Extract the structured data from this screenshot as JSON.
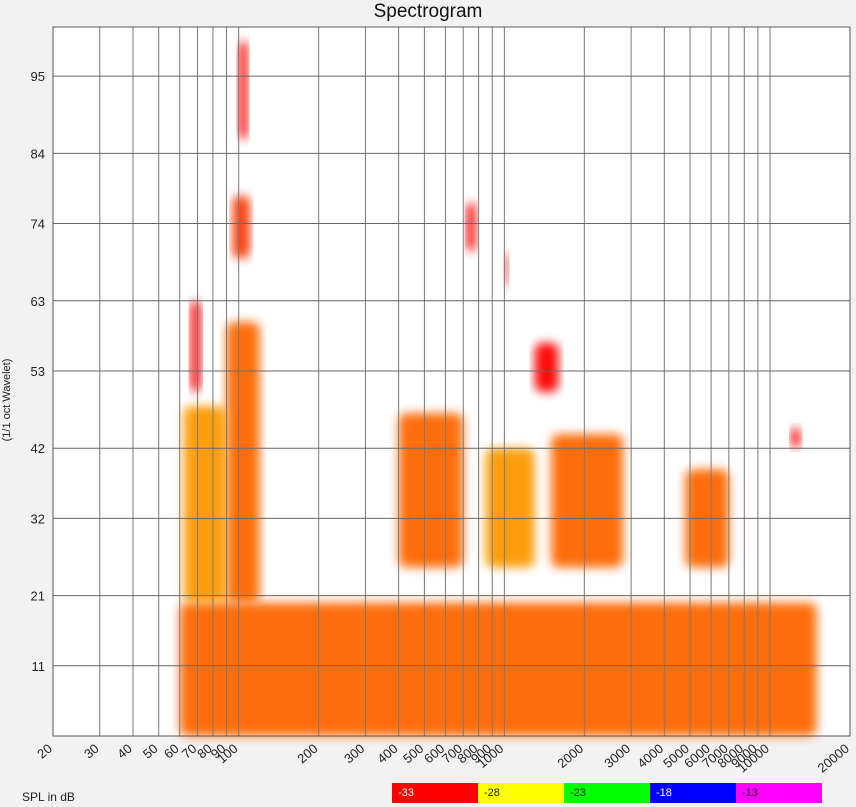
{
  "chart_data": {
    "type": "heatmap",
    "title": "Spectrogram",
    "xlabel": "",
    "ylabel": "(1/1 oct Wavelet)",
    "x_scale": "log",
    "xlim": [
      20,
      20000
    ],
    "ylim": [
      1,
      102
    ],
    "x_ticks": [
      20,
      30,
      40,
      50,
      60,
      70,
      80,
      90,
      100,
      200,
      300,
      400,
      500,
      600,
      700,
      800,
      900,
      1000,
      2000,
      3000,
      4000,
      5000,
      6000,
      7000,
      8000,
      9000,
      10000,
      20000
    ],
    "x_tick_labels": [
      "20",
      "30",
      "40",
      "50",
      "60",
      "70",
      "80",
      "90",
      "100",
      "200",
      "300",
      "400",
      "500",
      "600",
      "700",
      "800",
      "900",
      "1000",
      "2000",
      "3000",
      "4000",
      "5000",
      "6000",
      "7000",
      "8000",
      "9000",
      "10000",
      "20000"
    ],
    "y_ticks": [
      11,
      21,
      32,
      42,
      53,
      63,
      74,
      84,
      95
    ],
    "grid": true,
    "legend": {
      "title": "SPL in dB",
      "placement": "bottom",
      "items": [
        {
          "label": "-33",
          "color": "#ff0000"
        },
        {
          "label": "-28",
          "color": "#ffff00"
        },
        {
          "label": "-23",
          "color": "#00ff00"
        },
        {
          "label": "-18",
          "color": "#0000ff"
        },
        {
          "label": "-13",
          "color": "#ff00ff"
        }
      ]
    },
    "regions": [
      {
        "x": [
          60,
          15000
        ],
        "y": [
          1,
          20
        ],
        "level": -31
      },
      {
        "x": [
          100,
          108
        ],
        "y": [
          86,
          100
        ],
        "level": -33
      },
      {
        "x": [
          95,
          110
        ],
        "y": [
          69,
          78
        ],
        "level": -32
      },
      {
        "x": [
          66,
          72
        ],
        "y": [
          50,
          63
        ],
        "level": -33
      },
      {
        "x": [
          90,
          120
        ],
        "y": [
          20,
          60
        ],
        "level": -31
      },
      {
        "x": [
          62,
          90
        ],
        "y": [
          20,
          48
        ],
        "level": -30
      },
      {
        "x": [
          720,
          780
        ],
        "y": [
          70,
          77
        ],
        "level": -33
      },
      {
        "x": [
          1000,
          1020
        ],
        "y": [
          65,
          70
        ],
        "level": -33
      },
      {
        "x": [
          1300,
          1600
        ],
        "y": [
          50,
          57
        ],
        "level": -33
      },
      {
        "x": [
          400,
          700
        ],
        "y": [
          25,
          47
        ],
        "level": -31
      },
      {
        "x": [
          850,
          1300
        ],
        "y": [
          25,
          42
        ],
        "level": -30
      },
      {
        "x": [
          1500,
          2800
        ],
        "y": [
          25,
          44
        ],
        "level": -31
      },
      {
        "x": [
          4800,
          7000
        ],
        "y": [
          25,
          39
        ],
        "level": -31
      },
      {
        "x": [
          12000,
          13000
        ],
        "y": [
          42,
          45
        ],
        "level": -33
      }
    ]
  }
}
